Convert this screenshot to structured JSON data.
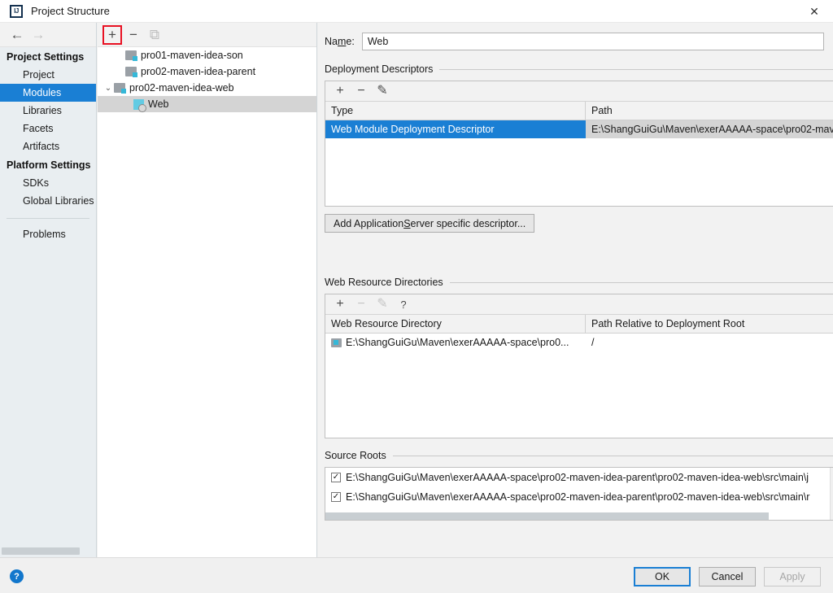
{
  "window": {
    "title": "Project Structure",
    "logo_text": "IJ",
    "close_icon": "close-icon"
  },
  "nav": {
    "back_icon": "←",
    "forward_icon": "→"
  },
  "sidebar": {
    "groups": [
      {
        "label": "Project Settings",
        "items": [
          {
            "label": "Project",
            "selected": false
          },
          {
            "label": "Modules",
            "selected": true
          },
          {
            "label": "Libraries",
            "selected": false
          },
          {
            "label": "Facets",
            "selected": false
          },
          {
            "label": "Artifacts",
            "selected": false
          }
        ]
      },
      {
        "label": "Platform Settings",
        "items": [
          {
            "label": "SDKs",
            "selected": false
          },
          {
            "label": "Global Libraries",
            "selected": false
          }
        ]
      }
    ],
    "problems_label": "Problems"
  },
  "tree": {
    "toolbar": {
      "add_icon": "+",
      "remove_icon": "−",
      "copy_icon": "⧉"
    },
    "nodes": [
      {
        "label": "pro01-maven-idea-son",
        "kind": "module",
        "indent": 1,
        "twisty": "",
        "selected": false
      },
      {
        "label": "pro02-maven-idea-parent",
        "kind": "module",
        "indent": 1,
        "twisty": "",
        "selected": false
      },
      {
        "label": "pro02-maven-idea-web",
        "kind": "module",
        "indent": 1,
        "twisty": "⌄",
        "selected": false
      },
      {
        "label": "Web",
        "kind": "facet",
        "indent": 2,
        "twisty": "",
        "selected": true
      }
    ]
  },
  "main": {
    "name_label_a": "Na",
    "name_label_mnemonic": "m",
    "name_label_b": "e:",
    "name_value": "Web",
    "name_placeholder": "",
    "deployment_descriptors": {
      "title": "Deployment Descriptors",
      "toolbar": {
        "add_icon": "+",
        "remove_icon": "−",
        "edit_icon": "✎"
      },
      "columns": [
        "Type",
        "Path"
      ],
      "rows": [
        {
          "type": "Web Module Deployment Descriptor",
          "path": "E:\\ShangGuiGu\\Maven\\exerAAAAA-space\\pro02-mav",
          "selected": true
        }
      ],
      "add_button_a": "Add Application ",
      "add_button_mnemonic": "S",
      "add_button_b": "erver specific descriptor..."
    },
    "web_resource_directories": {
      "title": "Web Resource Directories",
      "toolbar": {
        "add_icon": "+",
        "remove_icon": "−",
        "edit_icon": "✎",
        "help_icon": "?"
      },
      "columns": [
        "Web Resource Directory",
        "Path Relative to Deployment Root"
      ],
      "rows": [
        {
          "directory": "E:\\ShangGuiGu\\Maven\\exerAAAAA-space\\pro0...",
          "relative_path": "/"
        }
      ]
    },
    "source_roots": {
      "title": "Source Roots",
      "rows": [
        {
          "checked": true,
          "check_glyph": "✓",
          "path": "E:\\ShangGuiGu\\Maven\\exerAAAAA-space\\pro02-maven-idea-parent\\pro02-maven-idea-web\\src\\main\\j"
        },
        {
          "checked": true,
          "check_glyph": "✓",
          "path": "E:\\ShangGuiGu\\Maven\\exerAAAAA-space\\pro02-maven-idea-parent\\pro02-maven-idea-web\\src\\main\\r"
        }
      ]
    }
  },
  "footer": {
    "help_icon": "?",
    "ok_label": "OK",
    "cancel_label": "Cancel",
    "apply_label": "Apply"
  },
  "colors": {
    "selection_blue": "#1a7fd4",
    "highlight_red": "#e81123",
    "sidebar_bg": "#e9eef1",
    "help_blue": "#1277cc",
    "module_badge_cyan": "#35b8d8"
  }
}
